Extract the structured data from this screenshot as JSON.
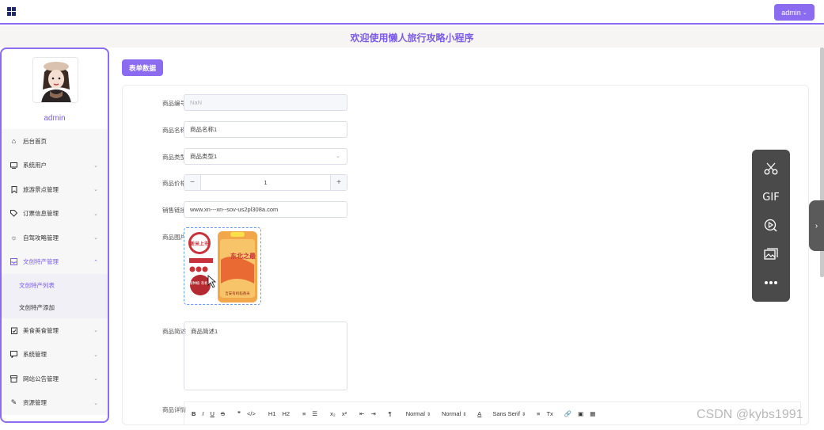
{
  "header": {
    "user_menu_label": "admin",
    "user_menu_caret": "⌄",
    "site_title": "欢迎使用懒人旅行攻略小程序"
  },
  "sidebar": {
    "username": "admin",
    "items": [
      {
        "label": "后台首页",
        "icon": "home-icon",
        "has_children": false
      },
      {
        "label": "系统用户",
        "icon": "monitor-icon",
        "has_children": true
      },
      {
        "label": "旅游景点管理",
        "icon": "bookmark-icon",
        "has_children": true
      },
      {
        "label": "订票信息管理",
        "icon": "tag-icon",
        "has_children": true
      },
      {
        "label": "自驾攻略管理",
        "icon": "sun-icon",
        "has_children": true
      },
      {
        "label": "文创特产管理",
        "icon": "inbox-icon",
        "has_children": true,
        "expanded": true,
        "children": [
          {
            "label": "文创特产列表",
            "active": true
          },
          {
            "label": "文创特产添加",
            "active": false
          }
        ]
      },
      {
        "label": "美食美食管理",
        "icon": "clipboard-check-icon",
        "has_children": true
      },
      {
        "label": "系统管理",
        "icon": "chat-icon",
        "has_children": true
      },
      {
        "label": "网站公告管理",
        "icon": "archive-icon",
        "has_children": true
      },
      {
        "label": "资源管理",
        "icon": "paperclip-icon",
        "has_children": true
      }
    ]
  },
  "main": {
    "tag_button_label": "表单数据",
    "form": {
      "id_label": "商品编号",
      "id_value": "NaN",
      "name_label": "商品名称",
      "name_value": "商品名称1",
      "type_label": "商品类型",
      "type_value": "商品类型1",
      "price_label": "商品价格",
      "price_value": "1",
      "price_minus": "−",
      "price_plus": "+",
      "link_label": "销售链接",
      "link_value": "www.xn---xn--sov-us2pl308a.com",
      "image_label": "商品图片",
      "image_texts": {
        "badge": "新米上市",
        "seal": "原粮种植 有机认证",
        "bag_title": "东北之最",
        "bag_sub": "吉安有机稻香米"
      },
      "desc_label": "商品简述",
      "desc_value": "商品简述1",
      "detail_label": "商品详情"
    },
    "editor_toolbar": [
      "B",
      "I",
      "U",
      "S",
      "❞",
      "</>",
      "H1",
      "H2",
      "≡",
      "☰",
      "x₂",
      "x²",
      "⇤",
      "⇥",
      "¶",
      "Normal",
      "Normal",
      "A",
      "Sans Serif",
      "≡",
      "Tx",
      "🔗",
      "▣",
      "▦"
    ]
  },
  "tool_panel": {
    "tools": [
      "scissors-icon",
      "gif-icon",
      "video-search-icon",
      "image-icon",
      "more-icon"
    ],
    "gif_label": "GIF"
  },
  "watermark": "CSDN @kybs1991"
}
